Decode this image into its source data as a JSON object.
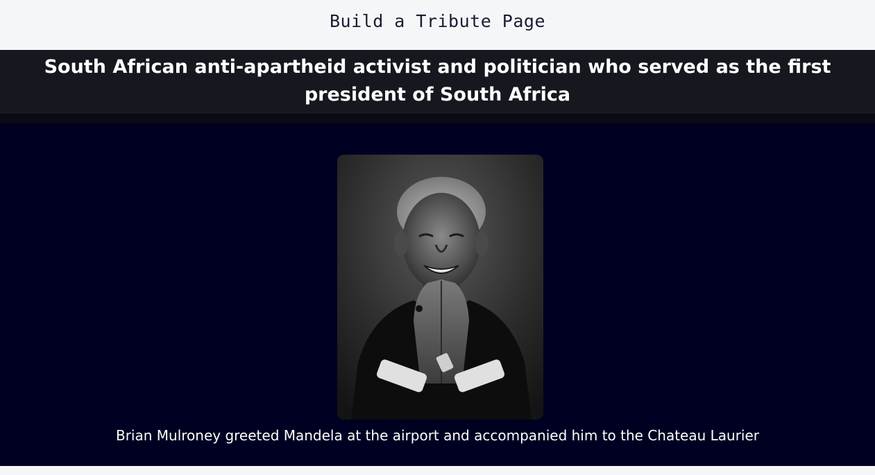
{
  "page": {
    "title": "Build a Tribute Page"
  },
  "header": {
    "headline": "South African anti-apartheid activist and politician who served as the first president of South Africa"
  },
  "figure": {
    "image_alt": "Portrait of Nelson Mandela with hands pressed together",
    "caption": "Brian Mulroney greeted Mandela at the airport and accompanied him to the Chateau Laurier"
  },
  "colors": {
    "header_bg": "#15181f",
    "main_bg": "#000022",
    "top_bar_bg": "#f5f6f7",
    "text_light": "#ffffff",
    "text_dark": "#1b1b32"
  }
}
